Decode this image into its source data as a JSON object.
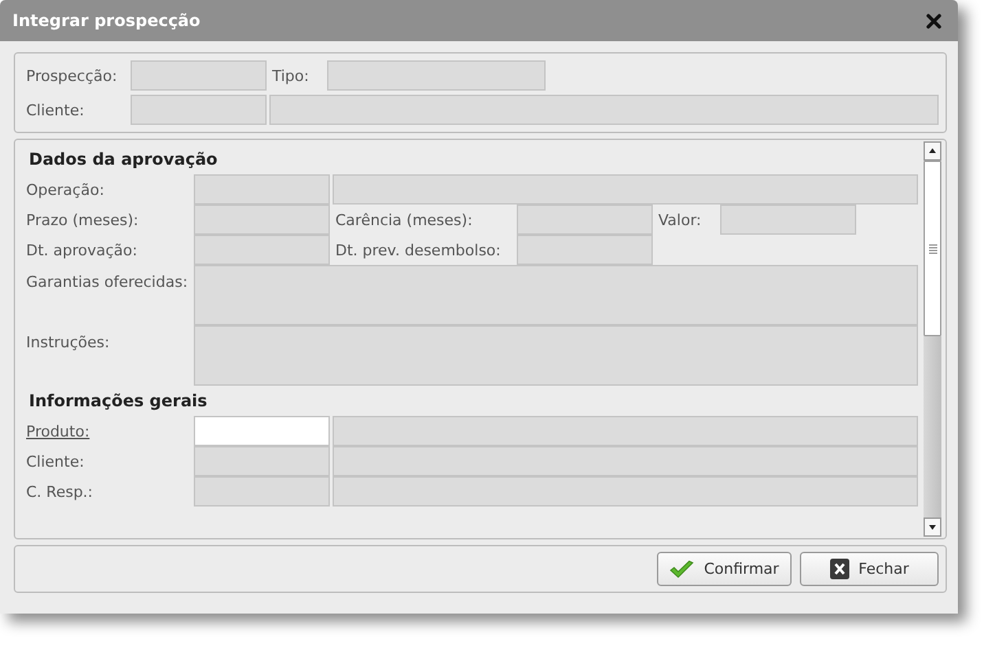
{
  "window": {
    "title": "Integrar prospecção"
  },
  "header": {
    "rows": [
      {
        "kind": "inline",
        "label": "Prospecção:",
        "underlined": false,
        "fields": [
          {
            "disabled": true
          }
        ],
        "extras": [
          {
            "label": "Tipo:",
            "field": {
              "disabled": true
            }
          }
        ]
      },
      {
        "kind": "pair",
        "label": "Cliente:",
        "underlined": false,
        "fields": [
          {
            "disabled": true
          },
          {
            "disabled": true
          }
        ]
      }
    ]
  },
  "sections": [
    {
      "heading": "Dados da aprovação",
      "rows": [
        {
          "kind": "pair",
          "label": "Operação:",
          "underlined": false,
          "fields": [
            {
              "disabled": true
            },
            {
              "disabled": true
            }
          ]
        },
        {
          "kind": "inline",
          "label": "Prazo (meses):",
          "underlined": false,
          "fields": [
            {
              "disabled": true
            }
          ],
          "extras": [
            {
              "label": "Carência (meses):",
              "field": {
                "disabled": true
              }
            },
            {
              "label": "Valor:",
              "field": {
                "disabled": true
              }
            }
          ]
        },
        {
          "kind": "inline",
          "label": "Dt. aprovação:",
          "underlined": false,
          "fields": [
            {
              "disabled": true
            }
          ],
          "extras": [
            {
              "label": "Dt. prev. desembolso:",
              "field": {
                "disabled": true
              }
            }
          ]
        },
        {
          "kind": "area",
          "label": "Garantias oferecidas:",
          "underlined": false,
          "fields": [
            {
              "disabled": true
            }
          ]
        },
        {
          "kind": "area",
          "label": "Instruções:",
          "underlined": false,
          "fields": [
            {
              "disabled": true
            }
          ]
        }
      ]
    },
    {
      "heading": "Informações gerais",
      "rows": [
        {
          "kind": "pair",
          "label": "Produto:",
          "underlined": true,
          "fields": [
            {
              "disabled": false
            },
            {
              "disabled": true
            }
          ]
        },
        {
          "kind": "pair",
          "label": "Cliente:",
          "underlined": false,
          "fields": [
            {
              "disabled": true
            },
            {
              "disabled": true
            }
          ]
        },
        {
          "kind": "pair",
          "label": "C. Resp.:",
          "underlined": false,
          "fields": [
            {
              "disabled": true
            },
            {
              "disabled": true
            }
          ]
        }
      ]
    }
  ],
  "buttons": [
    {
      "kind": "confirm",
      "label": "Confirmar"
    },
    {
      "kind": "close",
      "label": "Fechar"
    }
  ]
}
